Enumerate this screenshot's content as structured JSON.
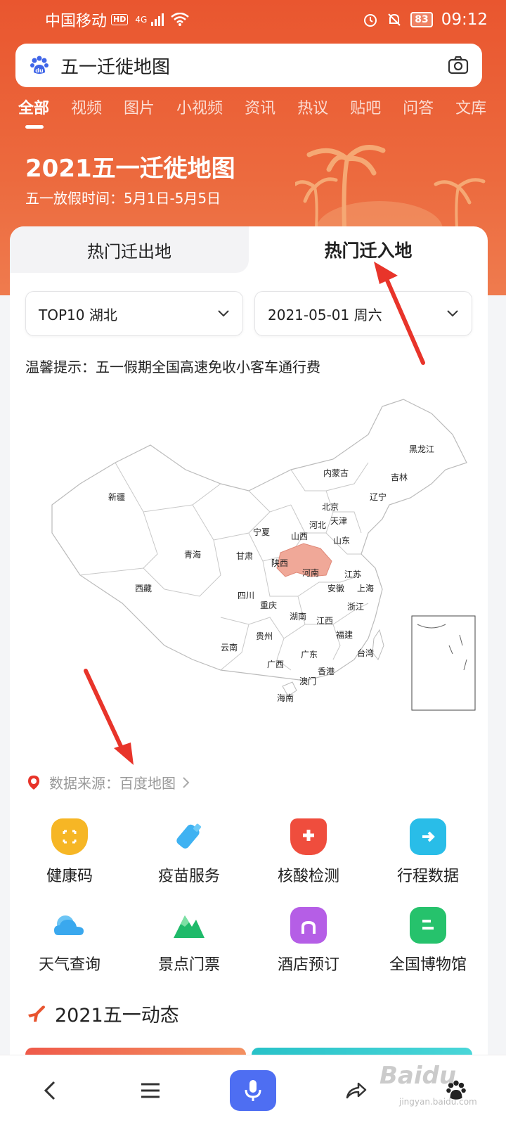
{
  "status_bar": {
    "carrier": "中国移动",
    "hd": "HD",
    "network": "4G",
    "battery": "83",
    "time": "09:12"
  },
  "search": {
    "query": "五一迁徙地图"
  },
  "tabs": [
    {
      "label": "全部",
      "active": true
    },
    {
      "label": "视频"
    },
    {
      "label": "图片"
    },
    {
      "label": "小视频"
    },
    {
      "label": "资讯"
    },
    {
      "label": "热议"
    },
    {
      "label": "贴吧"
    },
    {
      "label": "问答"
    },
    {
      "label": "文库"
    }
  ],
  "hero": {
    "title": "2021五一迁徙地图",
    "subtitle": "五一放假时间：5月1日-5月5日"
  },
  "card": {
    "sub_tabs": [
      "热门迁出地",
      "热门迁入地"
    ],
    "select_region": "TOP10 湖北",
    "select_date": "2021-05-01 周六",
    "tip": "温馨提示：五一假期全国高速免收小客车通行费",
    "map": {
      "highlight": "湖北",
      "highlight_color": "#f0a898",
      "provinces": [
        "黑龙江",
        "吉林",
        "辽宁",
        "内蒙古",
        "新疆",
        "北京",
        "天津",
        "河北",
        "宁夏",
        "山西",
        "山东",
        "青海",
        "甘肃",
        "陕西",
        "河南",
        "江苏",
        "西藏",
        "四川",
        "安徽",
        "上海",
        "重庆",
        "浙江",
        "湖南",
        "江西",
        "贵州",
        "福建",
        "云南",
        "广东",
        "台湾",
        "广西",
        "香港",
        "澳门",
        "海南"
      ]
    },
    "source": "数据来源：百度地图",
    "services": [
      {
        "label": "健康码",
        "icon": "health-code-icon",
        "color": "#f6b625"
      },
      {
        "label": "疫苗服务",
        "icon": "vaccine-icon",
        "color": "#3fb2f2"
      },
      {
        "label": "核酸检测",
        "icon": "nucleic-test-icon",
        "color": "#ef4d3d"
      },
      {
        "label": "行程数据",
        "icon": "itinerary-icon",
        "color": "#29bde8"
      },
      {
        "label": "天气查询",
        "icon": "weather-icon",
        "color": "#3aa8ee"
      },
      {
        "label": "景点门票",
        "icon": "scenic-ticket-icon",
        "color": "#1fba6a"
      },
      {
        "label": "酒店预订",
        "icon": "hotel-icon",
        "color": "#b55ee6"
      },
      {
        "label": "全国博物馆",
        "icon": "museum-icon",
        "color": "#26c26c"
      }
    ],
    "dynamics_title": "2021五一动态"
  },
  "watermark": {
    "brand": "Baidu",
    "sub": "jingyan.baidu.com"
  },
  "colors": {
    "header": "#e9562f",
    "accent": "#4e6ef2",
    "annotation": "#e8342a"
  }
}
